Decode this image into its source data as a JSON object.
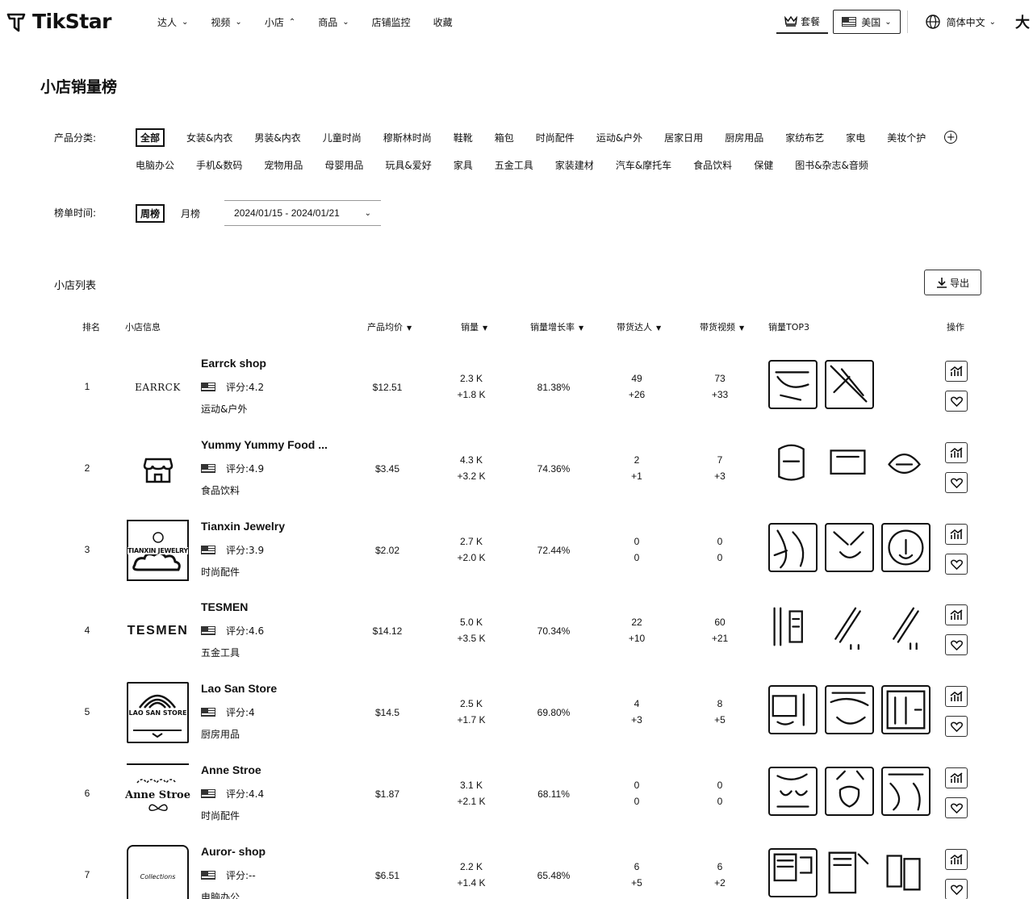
{
  "brand": {
    "name": "TikStar"
  },
  "nav": [
    {
      "label": "达人",
      "arrow": "down"
    },
    {
      "label": "视频",
      "arrow": "down"
    },
    {
      "label": "小店",
      "arrow": "up"
    },
    {
      "label": "商品",
      "arrow": "down"
    },
    {
      "label": "店铺监控",
      "arrow": ""
    },
    {
      "label": "收藏",
      "arrow": ""
    }
  ],
  "header_right": {
    "package": "套餐",
    "region": "美国",
    "language": "简体中文",
    "trailing": "大"
  },
  "page_title": "小店销量榜",
  "filters": {
    "category_label": "产品分类:",
    "categories_row1": [
      "全部",
      "女装&内衣",
      "男装&内衣",
      "儿童时尚",
      "穆斯林时尚",
      "鞋靴",
      "箱包",
      "时尚配件",
      "运动&户外",
      "居家日用",
      "厨房用品",
      "家纺布艺",
      "家电",
      "美妆个护"
    ],
    "categories_row2": [
      "电脑办公",
      "手机&数码",
      "宠物用品",
      "母婴用品",
      "玩具&爱好",
      "家具",
      "五金工具",
      "家装建材",
      "汽车&摩托车",
      "食品饮料",
      "保健",
      "图书&杂志&音频"
    ],
    "active_category": "全部",
    "time_label": "榜单时间:",
    "time_tabs": [
      "周榜",
      "月榜"
    ],
    "active_time": "周榜",
    "date_range": "2024/01/15 - 2024/01/21"
  },
  "list": {
    "title": "小店列表",
    "export_label": "导出",
    "columns": {
      "rank": "排名",
      "shop": "小店信息",
      "avg_price": "产品均价",
      "sales": "销量",
      "growth": "销量增长率",
      "creators": "带货达人",
      "videos": "带货视频",
      "top3": "销量TOP3",
      "ops": "操作"
    },
    "rows": [
      {
        "rank": "1",
        "name": "Earrck shop",
        "rating": "评分:4.2",
        "category": "运动&户外",
        "logo_text": "EARRCK",
        "price": "$12.51",
        "sales": "2.3 K",
        "sales_delta": "+1.8 K",
        "growth": "81.38%",
        "creators": "49",
        "creators_delta": "+26",
        "videos": "73",
        "videos_delta": "+33",
        "thumbs": 2
      },
      {
        "rank": "2",
        "name": "Yummy Yummy Food ...",
        "rating": "评分:4.9",
        "category": "食品饮料",
        "logo_text": "",
        "price": "$3.45",
        "sales": "4.3 K",
        "sales_delta": "+3.2 K",
        "growth": "74.36%",
        "creators": "2",
        "creators_delta": "+1",
        "videos": "7",
        "videos_delta": "+3",
        "thumbs": 3
      },
      {
        "rank": "3",
        "name": "Tianxin Jewelry",
        "rating": "评分:3.9",
        "category": "时尚配件",
        "logo_text": "TIANXIN JEWELRY",
        "price": "$2.02",
        "sales": "2.7 K",
        "sales_delta": "+2.0 K",
        "growth": "72.44%",
        "creators": "0",
        "creators_delta": "0",
        "videos": "0",
        "videos_delta": "0",
        "thumbs": 3
      },
      {
        "rank": "4",
        "name": "TESMEN",
        "rating": "评分:4.6",
        "category": "五金工具",
        "logo_text": "TESMEN",
        "price": "$14.12",
        "sales": "5.0 K",
        "sales_delta": "+3.5 K",
        "growth": "70.34%",
        "creators": "22",
        "creators_delta": "+10",
        "videos": "60",
        "videos_delta": "+21",
        "thumbs": 3
      },
      {
        "rank": "5",
        "name": "Lao San Store",
        "rating": "评分:4",
        "category": "厨房用品",
        "logo_text": "LAO SAN STORE",
        "price": "$14.5",
        "sales": "2.5 K",
        "sales_delta": "+1.7 K",
        "growth": "69.80%",
        "creators": "4",
        "creators_delta": "+3",
        "videos": "8",
        "videos_delta": "+5",
        "thumbs": 3
      },
      {
        "rank": "6",
        "name": "Anne Stroe",
        "rating": "评分:4.4",
        "category": "时尚配件",
        "logo_text": "Anne Stroe",
        "price": "$1.87",
        "sales": "3.1 K",
        "sales_delta": "+2.1 K",
        "growth": "68.11%",
        "creators": "0",
        "creators_delta": "0",
        "videos": "0",
        "videos_delta": "0",
        "thumbs": 3
      },
      {
        "rank": "7",
        "name": "Auror- shop",
        "rating": "评分:--",
        "category": "电脑办公",
        "logo_text": "Collections",
        "price": "$6.51",
        "sales": "2.2 K",
        "sales_delta": "+1.4 K",
        "growth": "65.48%",
        "creators": "6",
        "creators_delta": "+5",
        "videos": "6",
        "videos_delta": "+2",
        "thumbs": 3
      }
    ]
  }
}
